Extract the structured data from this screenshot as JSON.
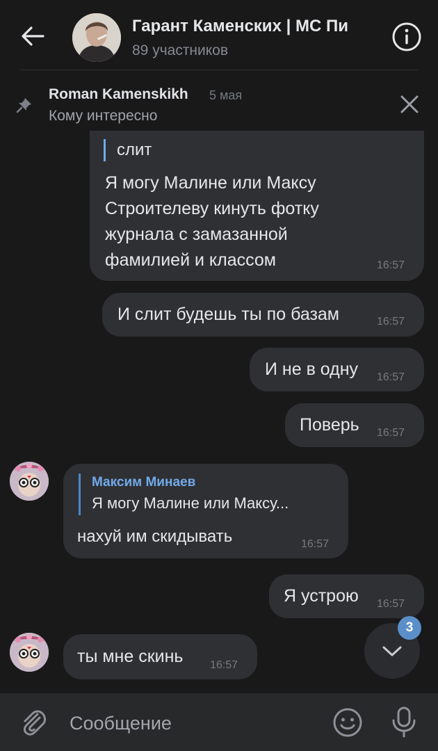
{
  "header": {
    "title": "Гарант Каменских | МС Пи",
    "subtitle": "89 участников"
  },
  "pinned": {
    "author": "Roman Kamenskikh",
    "date": "5 мая",
    "text": "Кому интересно"
  },
  "messages": [
    {
      "id": "m1",
      "side": "out",
      "quote_text": "слит",
      "lines": [
        "Я могу Малине или Максу",
        "Строителеву кинуть фотку",
        "журнала с замазанной",
        "фамилией и классом"
      ],
      "time": "16:57"
    },
    {
      "id": "m2",
      "side": "out",
      "text": "И слит будешь ты по базам",
      "time": "16:57"
    },
    {
      "id": "m3",
      "side": "out",
      "text": "И не в одну",
      "time": "16:57"
    },
    {
      "id": "m4",
      "side": "out",
      "text": "Поверь",
      "time": "16:57"
    },
    {
      "id": "m5",
      "side": "in",
      "quote_author": "Максим Минаев",
      "quote_text": "Я могу Малине или Максу...",
      "text": "нахуй им скидывать",
      "time": "16:57"
    },
    {
      "id": "m6",
      "side": "out",
      "text": "Я устрою",
      "time": "16:57"
    },
    {
      "id": "m7",
      "side": "in",
      "text": "ты мне скинь",
      "time": "16:57"
    }
  ],
  "scroll_down": {
    "unread_count": "3"
  },
  "composer": {
    "placeholder": "Сообщение"
  },
  "colors": {
    "background": "#19191a",
    "bubble": "#2f3033",
    "accent": "#71aaeb",
    "badge": "#5b8fca"
  },
  "icons": [
    "back-arrow-icon",
    "info-icon",
    "pin-icon",
    "close-icon",
    "chevron-down-icon",
    "paperclip-icon",
    "emoji-icon",
    "microphone-icon"
  ]
}
